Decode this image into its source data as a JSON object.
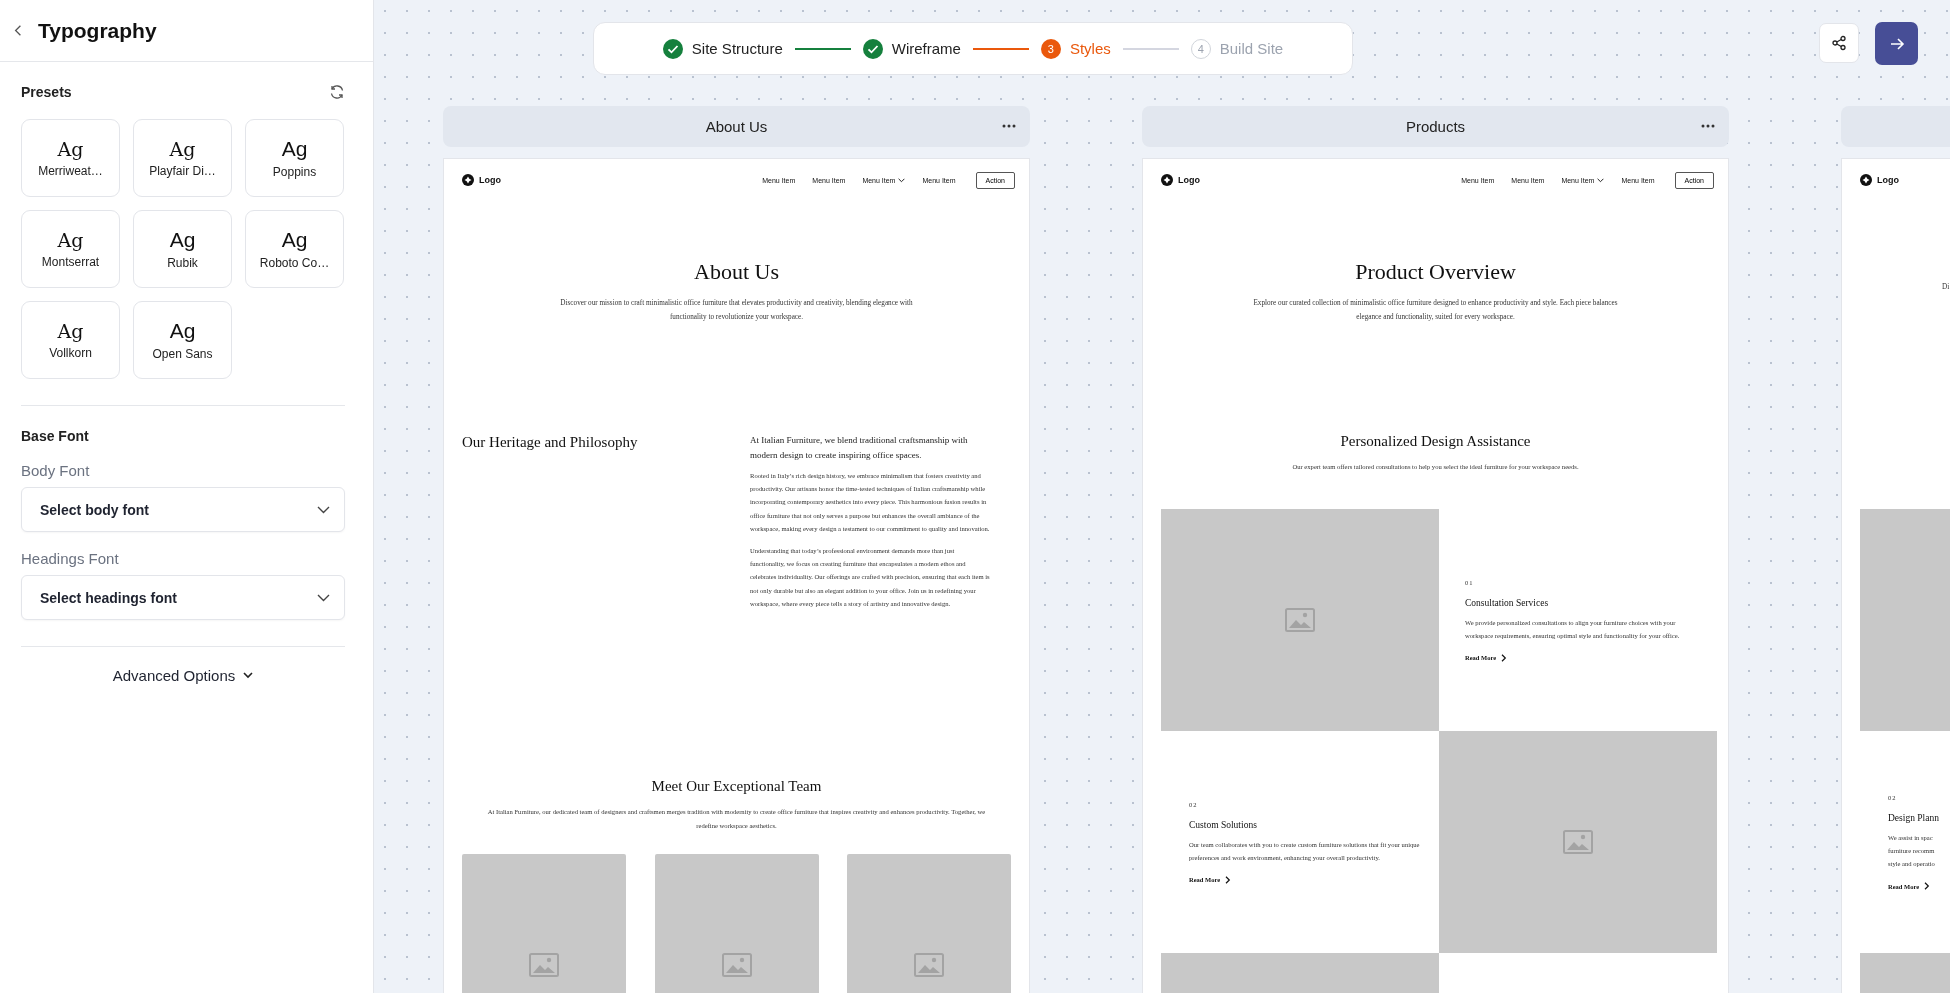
{
  "sidebar": {
    "title": "Typography",
    "presets_title": "Presets",
    "presets": [
      {
        "sample": "Ag",
        "label": "Merriweat…",
        "kind": "serif"
      },
      {
        "sample": "Ag",
        "label": "Playfair Di…",
        "kind": "serif"
      },
      {
        "sample": "Ag",
        "label": "Poppins",
        "kind": "sans"
      },
      {
        "sample": "Ag",
        "label": "Montserrat",
        "kind": "serif"
      },
      {
        "sample": "Ag",
        "label": "Rubik",
        "kind": "sans"
      },
      {
        "sample": "Ag",
        "label": "Roboto Co…",
        "kind": "sans"
      },
      {
        "sample": "Ag",
        "label": "Vollkorn",
        "kind": "serif"
      },
      {
        "sample": "Ag",
        "label": "Open Sans",
        "kind": "sans"
      }
    ],
    "base_font_title": "Base Font",
    "fields": [
      {
        "label": "Body Font",
        "placeholder": "Select body font"
      },
      {
        "label": "Headings Font",
        "placeholder": "Select headings font"
      }
    ],
    "advanced": "Advanced Options"
  },
  "steps": [
    {
      "label": "Site Structure",
      "done": true,
      "selected": false
    },
    {
      "label": "Wireframe",
      "done": true,
      "selected": false
    },
    {
      "number": "3",
      "label": "Styles",
      "done": false,
      "selected": true
    },
    {
      "number": "4",
      "label": "Build Site",
      "done": false,
      "selected": false
    }
  ],
  "pages": [
    {
      "label": "About Us",
      "nav": {
        "logo": "Logo",
        "items": [
          {
            "label": "Menu Item",
            "dropdown": false
          },
          {
            "label": "Menu Item",
            "dropdown": false
          },
          {
            "label": "Menu Item",
            "dropdown": true
          },
          {
            "label": "Menu Item",
            "dropdown": false
          }
        ],
        "action": "Action"
      },
      "sections": [
        {
          "kind": "hero",
          "title": "About Us",
          "text": "Discover our mission to craft minimalistic office furniture that elevates productivity and creativity, blending elegance with functionality to revolutionize your workspace."
        },
        {
          "kind": "split",
          "heading": "Our Heritage and Philosophy",
          "lead": "At Italian Furniture, we blend traditional craftsmanship with modern design to create inspiring office spaces.",
          "paragraphs": [
            "Rooted in Italy’s rich design history, we embrace minimalism that fosters creativity and productivity. Our artisans honor the time-tested techniques of Italian craftsmanship while incorporating contemporary aesthetics into every piece. This harmonious fusion results in office furniture that not only serves a purpose but enhances the overall ambiance of the workspace, making every design a testament to our commitment to quality and innovation.",
            "Understanding that today’s professional environment demands more than just functionality, we focus on creating furniture that encapsulates a modern ethos and celebrates individuality. Our offerings are crafted with precision, ensuring that each item is not only durable but also an elegant addition to your office. Join us in redefining your workspace, where every piece tells a story of artistry and innovative design."
          ]
        },
        {
          "kind": "team",
          "heading": "Meet Our Exceptional Team",
          "text": "At Italian Furniture, our dedicated team of designers and craftsmen merges tradition with modernity to create office furniture that inspires creativity and enhances productivity. Together, we redefine workspace aesthetics.",
          "images": [
            {
              "kind": "placeholder"
            },
            {
              "kind": "placeholder"
            },
            {
              "kind": "placeholder"
            }
          ]
        }
      ]
    },
    {
      "label": "Products",
      "nav": {
        "logo": "Logo",
        "items": [
          {
            "label": "Menu Item",
            "dropdown": false
          },
          {
            "label": "Menu Item",
            "dropdown": false
          },
          {
            "label": "Menu Item",
            "dropdown": true
          },
          {
            "label": "Menu Item",
            "dropdown": false
          }
        ],
        "action": "Action"
      },
      "sections": [
        {
          "kind": "hero",
          "title": "Product Overview",
          "text": "Explore our curated collection of minimalistic office furniture designed to enhance productivity and style. Each piece balances elegance and functionality, suited for every workspace."
        },
        {
          "kind": "features",
          "heading": "Personalized Design Assistance",
          "text": "Our expert team offers tailored consultations to help you select the ideal furniture for your workspace needs.",
          "rows": [
            {
              "image_first": true,
              "number": "01",
              "title": "Consultation Services",
              "text": "We provide personalized consultations to align your furniture choices with your workspace requirements, ensuring optimal style and functionality for your office.",
              "link": "Read More"
            },
            {
              "image_first": false,
              "number": "02",
              "title": "Custom Solutions",
              "text": "Our team collaborates with you to create custom furniture solutions that fit your unique preferences and work environment, enhancing your overall productivity.",
              "link": "Read More"
            },
            {
              "image_first": true
            }
          ]
        }
      ]
    },
    {
      "nav": {
        "logo": "Logo"
      },
      "sections": [
        {
          "kind": "hero",
          "text": "Di"
        },
        {
          "kind": "features",
          "rows": [
            {
              "image_first": true
            },
            {
              "image_first": false,
              "number": "02",
              "title": "Design Plann",
              "text_lines": [
                "We assist in spac",
                "furniture recomm",
                "style and operatio"
              ],
              "link": "Read More"
            },
            {
              "image_first": true
            }
          ]
        }
      ]
    }
  ]
}
